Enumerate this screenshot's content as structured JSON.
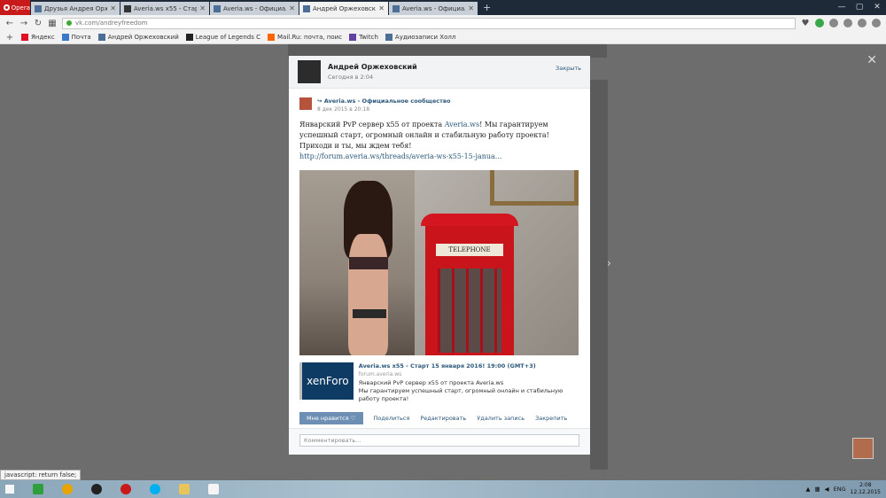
{
  "browser": {
    "opera_label": "Opera",
    "tabs": [
      {
        "label": "Друзья Андрея Орже...",
        "active": false
      },
      {
        "label": "Averia.ws x55 - Старт 15 ...",
        "active": false
      },
      {
        "label": "Averia.ws - Официальн...",
        "active": false
      },
      {
        "label": "Андрей Оржеховский",
        "active": true
      },
      {
        "label": "Averia.ws - Официальн...",
        "active": false
      }
    ],
    "url": "vk.com/andreyfreedom",
    "bookmarks": [
      "Яндекс",
      "Почта",
      "Андрей Оржеховский",
      "League of Legends С",
      "Mail.Ru: почта, поис",
      "Twitch",
      "Аудиозаписи Холл"
    ]
  },
  "modal": {
    "author_name": "Андрей Оржеховский",
    "post_date": "Сегодня в 2:04",
    "close_label": "Закрыть",
    "repost": {
      "community_name": "Averia.ws - Официальное сообщество",
      "date": "8 дек 2015 в 20:18"
    },
    "text": {
      "line1_prefix": "Январский PvP сервер x55 от проекта ",
      "line1_link": "Averia.ws",
      "line1_suffix": "! Мы гарантируем успешный старт, огромный онлайн и стабильную работу проекта!",
      "line2": "Приходи и ты, мы ждем тебя!",
      "link": "http://forum.averia.ws/threads/averia-ws-x55-15-janua..."
    },
    "photo": {
      "booth_sign": "TELEPHONE"
    },
    "link_card": {
      "logo_text": "xenForo",
      "title": "Averia.ws x55 - Старт 15 января 2016! 19:00 (GMT+3)",
      "domain": "forum.averia.ws",
      "desc1": "Январский PvP сервер x55 от проекта Averia.ws",
      "desc2": "Мы гарантируем успешный старт, огромный онлайн и стабильную работу проекта!"
    },
    "actions": {
      "like": "Мне нравится",
      "share": "Поделиться",
      "edit": "Редактировать",
      "delete": "Удалить запись",
      "pin": "Закрепить"
    },
    "comment_placeholder": "Комментировать..."
  },
  "status_text": "javascript: return false;",
  "taskbar": {
    "lang": "ENG",
    "time": "2:08",
    "date": "12.12.2015"
  }
}
